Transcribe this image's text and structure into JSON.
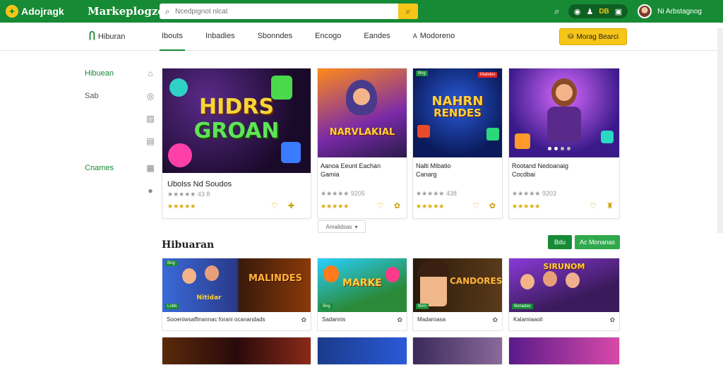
{
  "topbar": {
    "logo_text": "Adojragk",
    "brand": "Markeplogze",
    "search_placeholder": "Ncedpignot nlcat",
    "username": "Ni Arbstagnog",
    "pill_label": "DB"
  },
  "subnav": {
    "section_logo": "Hiburan",
    "tabs": [
      "Ibouts",
      "Inbadies",
      "Sbonndes",
      "Encogo",
      "Eandes",
      "Modoreno"
    ],
    "cta": "Morag Bearci"
  },
  "sidebar": {
    "items": [
      "Hibuean",
      "Sab",
      "",
      "",
      "Cnames",
      ""
    ]
  },
  "featured": [
    {
      "art_line1": "HIDRS",
      "art_line2": "GROAN",
      "title": "Ubolss Nd Soudos",
      "meta": "★★★★★ 43 8",
      "stars": "★★★★★"
    },
    {
      "art_line1": "NARVLAKIAL",
      "art_line2": "",
      "title": "Aanoa Eeunt Eachan",
      "title2": "Gamia",
      "meta": "★★★★★ 9205",
      "stars": "★★★★★",
      "badge_l": "",
      "badge_r": ""
    },
    {
      "art_line1": "NAHRN",
      "art_line2": "RENDES",
      "title": "Nalti Mibatio",
      "title2": "Canarg",
      "meta": "★★★★★ 438",
      "stars": "★★★★★",
      "badge_l": "Bng",
      "badge_r": "Mabdes"
    },
    {
      "art_line1": "",
      "art_line2": "",
      "title": "Rootand Nedoanaig",
      "title2": "Cocdbai",
      "meta": "★★★★★ 9203",
      "stars": "★★★★★"
    }
  ],
  "more_label": "Amalidsas",
  "section": {
    "title": "Hibuaran",
    "btn1": "Bdu",
    "btn2": "Ac Monanas"
  },
  "row": [
    {
      "caption": "Sooeniwsaffinannac forani ocanandads",
      "art1": "Nitidar",
      "art2": "MALINDES",
      "badge_top": "Bng",
      "badge_bot": "Lobb"
    },
    {
      "caption": "Sadannis",
      "art1": "MARKE",
      "badge_top": "",
      "badge_bot": "Bng"
    },
    {
      "caption": "Madaroasa",
      "art1": "CANDORES",
      "badge_top": "",
      "badge_bot": "Boni"
    },
    {
      "caption": "Kalamiaaoil",
      "art1": "SIRUNOM",
      "badge_top": "",
      "badge_bot": "Bonadas"
    }
  ],
  "colors": {
    "brand_green": "#178a35",
    "accent_yellow": "#f5c518"
  }
}
